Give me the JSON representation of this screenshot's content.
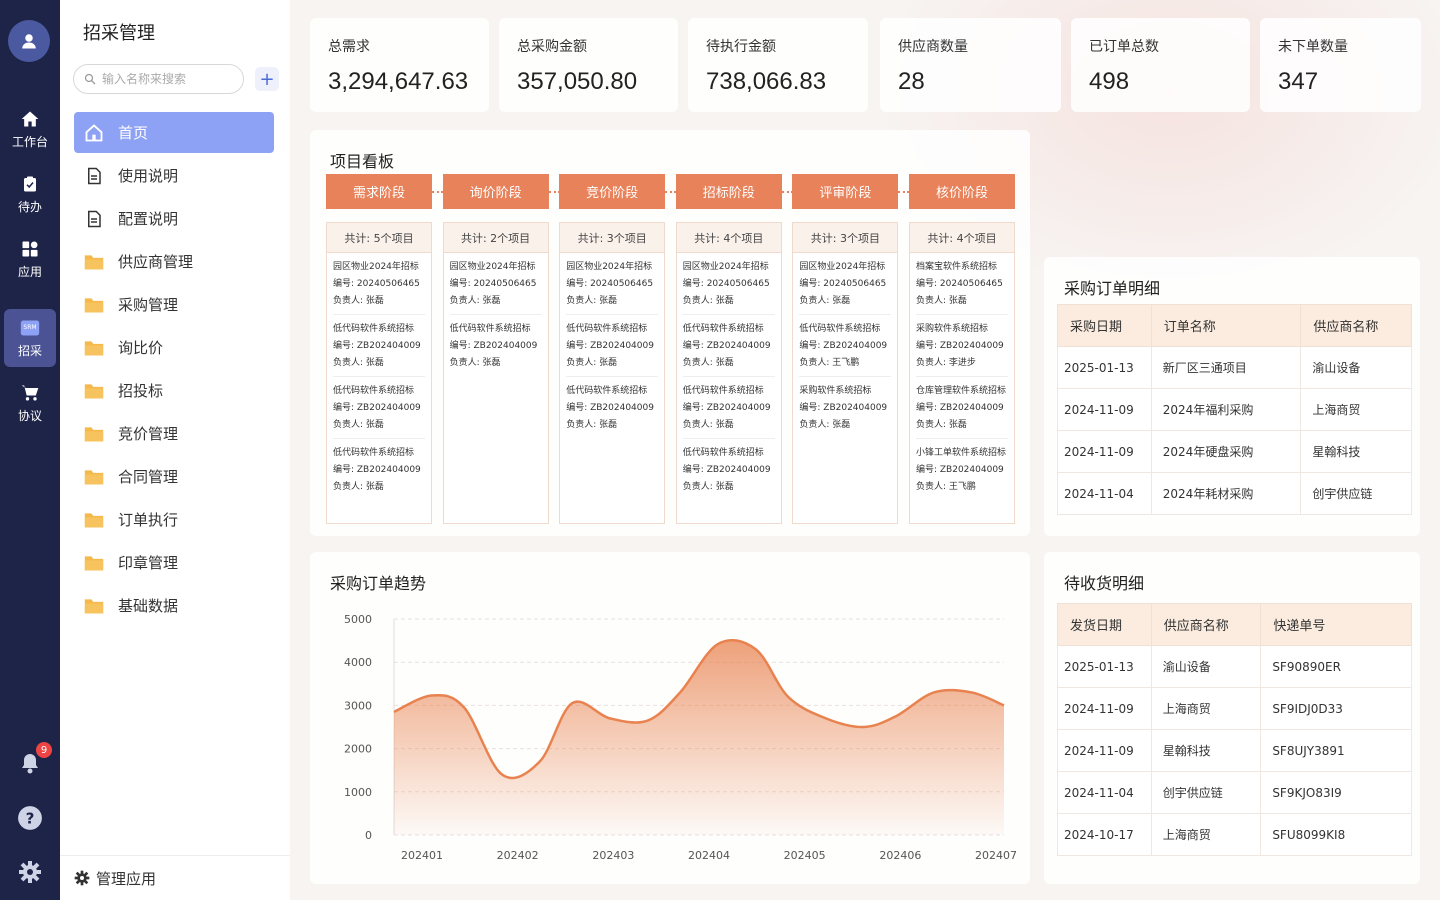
{
  "rail": {
    "items": [
      {
        "label": "工作台",
        "icon": "home-icon"
      },
      {
        "label": "待办",
        "icon": "clipboard-check-icon"
      },
      {
        "label": "应用",
        "icon": "grid-icon"
      },
      {
        "label": "招采",
        "icon": "srm-icon",
        "icon_text": "SRM"
      },
      {
        "label": "协议",
        "icon": "cart-icon"
      }
    ],
    "notification_count": "9"
  },
  "sidebar": {
    "title": "招采管理",
    "search_placeholder": "输入名称来搜索",
    "items": [
      {
        "label": "首页",
        "icon": "home-outline-icon"
      },
      {
        "label": "使用说明",
        "icon": "document-icon"
      },
      {
        "label": "配置说明",
        "icon": "document-icon"
      },
      {
        "label": "供应商管理",
        "icon": "folder-icon"
      },
      {
        "label": "采购管理",
        "icon": "folder-icon"
      },
      {
        "label": "询比价",
        "icon": "folder-icon"
      },
      {
        "label": "招投标",
        "icon": "folder-icon"
      },
      {
        "label": "竞价管理",
        "icon": "folder-icon"
      },
      {
        "label": "合同管理",
        "icon": "folder-icon"
      },
      {
        "label": "订单执行",
        "icon": "folder-icon"
      },
      {
        "label": "印章管理",
        "icon": "folder-icon"
      },
      {
        "label": "基础数据",
        "icon": "folder-icon"
      }
    ],
    "footer": "管理应用"
  },
  "stats": [
    {
      "label": "总需求",
      "value": "3,294,647.63"
    },
    {
      "label": "总采购金额",
      "value": "357,050.80"
    },
    {
      "label": "待执行金额",
      "value": "738,066.83"
    },
    {
      "label": "供应商数量",
      "value": "28"
    },
    {
      "label": "已订单总数",
      "value": "498"
    },
    {
      "label": "未下单数量",
      "value": "347"
    }
  ],
  "kanban": {
    "title": "项目看板",
    "stages": [
      {
        "name": "需求阶段",
        "count": "共计: 5个项目",
        "cards": [
          [
            "园区物业2024年招标",
            "编号: 20240506465",
            "负责人: 张磊"
          ],
          [
            "低代码软件系统招标",
            "编号: ZB202404009",
            "负责人: 张磊"
          ],
          [
            "低代码软件系统招标",
            "编号: ZB202404009",
            "负责人: 张磊"
          ],
          [
            "低代码软件系统招标",
            "编号: ZB202404009",
            "负责人: 张磊"
          ]
        ]
      },
      {
        "name": "询价阶段",
        "count": "共计: 2个项目",
        "cards": [
          [
            "园区物业2024年招标",
            "编号: 20240506465",
            "负责人: 张磊"
          ],
          [
            "低代码软件系统招标",
            "编号: ZB202404009",
            "负责人: 张磊"
          ]
        ]
      },
      {
        "name": "竞价阶段",
        "count": "共计: 3个项目",
        "cards": [
          [
            "园区物业2024年招标",
            "编号: 20240506465",
            "负责人: 张磊"
          ],
          [
            "低代码软件系统招标",
            "编号: ZB202404009",
            "负责人: 张磊"
          ],
          [
            "低代码软件系统招标",
            "编号: ZB202404009",
            "负责人: 张磊"
          ]
        ]
      },
      {
        "name": "招标阶段",
        "count": "共计: 4个项目",
        "cards": [
          [
            "园区物业2024年招标",
            "编号: 20240506465",
            "负责人: 张磊"
          ],
          [
            "低代码软件系统招标",
            "编号: ZB202404009",
            "负责人: 张磊"
          ],
          [
            "低代码软件系统招标",
            "编号: ZB202404009",
            "负责人: 张磊"
          ],
          [
            "低代码软件系统招标",
            "编号: ZB202404009",
            "负责人: 张磊"
          ]
        ]
      },
      {
        "name": "评审阶段",
        "count": "共计: 3个项目",
        "cards": [
          [
            "园区物业2024年招标",
            "编号: 20240506465",
            "负责人: 张磊"
          ],
          [
            "低代码软件系统招标",
            "编号: ZB202404009",
            "负责人: 王飞鹏"
          ],
          [
            "采购软件系统招标",
            "编号: ZB202404009",
            "负责人: 张磊"
          ]
        ]
      },
      {
        "name": "核价阶段",
        "count": "共计: 4个项目",
        "cards": [
          [
            "档案宝软件系统招标",
            "编号: 20240506465",
            "负责人: 张磊"
          ],
          [
            "采购软件系统招标",
            "编号: ZB202404009",
            "负责人: 李进步"
          ],
          [
            "仓库管理软件系统招标",
            "编号: ZB202404009",
            "负责人: 张磊"
          ],
          [
            "小锋工单软件系统招标",
            "编号: ZB202404009",
            "负责人: 王飞鹏"
          ]
        ]
      }
    ]
  },
  "orders": {
    "title": "采购订单明细",
    "headers": [
      "采购日期",
      "订单名称",
      "供应商名称"
    ],
    "rows": [
      [
        "2025-01-13",
        "新厂区三通项目",
        "渝山设备"
      ],
      [
        "2024-11-09",
        "2024年福利采购",
        "上海商贸"
      ],
      [
        "2024-11-09",
        "2024年硬盘采购",
        "星翰科技"
      ],
      [
        "2024-11-04",
        "2024年耗材采购",
        "创宇供应链"
      ]
    ]
  },
  "receipts": {
    "title": "待收货明细",
    "headers": [
      "发货日期",
      "供应商名称",
      "快递单号"
    ],
    "rows": [
      [
        "2025-01-13",
        "渝山设备",
        "SF90890ER"
      ],
      [
        "2024-11-09",
        "上海商贸",
        "SF9IDJ0D33"
      ],
      [
        "2024-11-09",
        "星翰科技",
        "SF8UJY3891"
      ],
      [
        "2024-11-04",
        "创宇供应链",
        "SF9KJO83I9"
      ],
      [
        "2024-10-17",
        "上海商贸",
        "SFU8099KI8"
      ]
    ]
  },
  "trend": {
    "title": "采购订单趋势"
  },
  "chart_data": {
    "type": "area",
    "x": [
      "202401",
      "202402",
      "202403",
      "202404",
      "202405",
      "202406",
      "202407"
    ],
    "points": [
      {
        "x": 0,
        "y": 2850
      },
      {
        "x": 0.35,
        "y": 3230
      },
      {
        "x": 0.65,
        "y": 2950
      },
      {
        "x": 1.0,
        "y": 1400
      },
      {
        "x": 1.35,
        "y": 1700
      },
      {
        "x": 1.65,
        "y": 3050
      },
      {
        "x": 2.0,
        "y": 2700
      },
      {
        "x": 2.35,
        "y": 2650
      },
      {
        "x": 2.65,
        "y": 3300
      },
      {
        "x": 3.0,
        "y": 4420
      },
      {
        "x": 3.35,
        "y": 4300
      },
      {
        "x": 3.65,
        "y": 3200
      },
      {
        "x": 4.0,
        "y": 2700
      },
      {
        "x": 4.35,
        "y": 2500
      },
      {
        "x": 4.65,
        "y": 2750
      },
      {
        "x": 5.0,
        "y": 3300
      },
      {
        "x": 5.35,
        "y": 3300
      },
      {
        "x": 5.65,
        "y": 3000
      }
    ],
    "ylim": [
      0,
      5000
    ],
    "yticks": [
      "5000",
      "4000",
      "3000",
      "2000",
      "1000",
      "0"
    ],
    "grid": true,
    "color": "#e8824f"
  },
  "colors": {
    "rail": "#1d2448",
    "accent": "#e8825a",
    "active_menu": "#8da2f5"
  }
}
